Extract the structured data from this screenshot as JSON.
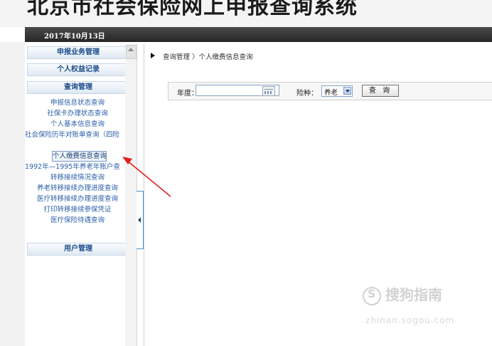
{
  "header": {
    "title": "北京市社会保险网上申报查询系统"
  },
  "datebar": {
    "date": "2017年10月13日"
  },
  "sidebar": {
    "sections": [
      {
        "label": "申报业务管理"
      },
      {
        "label": "个人权益记录"
      },
      {
        "label": "查询管理"
      },
      {
        "label": "用户管理"
      }
    ],
    "items": [
      {
        "label": "申报信息状态查询"
      },
      {
        "label": "社保卡办理状态查询"
      },
      {
        "label": "个人基本信息查询"
      },
      {
        "label": "社会保险历年对账单查询（四险"
      },
      {
        "label": "个人缴费信息查询"
      },
      {
        "label": "1992年—1995年养老年账户查"
      },
      {
        "label": "转移接续情况查询"
      },
      {
        "label": "养老转移接续办理进度查询"
      },
      {
        "label": "医疗转移接续办理进度查询"
      },
      {
        "label": "打印转移接续参保凭证"
      },
      {
        "label": "医疗保险待遇查询"
      }
    ],
    "active_item": "个人缴费信息查询"
  },
  "main": {
    "breadcrumb": "查询管理 〉个人缴费信息查询",
    "form": {
      "year_label": "年度：",
      "year_value": "",
      "insurance_label": "险种：",
      "insurance_value": "养老",
      "query_button": "查 询"
    }
  },
  "watermark": {
    "text": "搜狗指南",
    "url": "zhinan.sogou.com"
  },
  "colors": {
    "accent": "#2a5fa8",
    "annotation_arrow": "#e02020",
    "datebar": "#333333"
  }
}
